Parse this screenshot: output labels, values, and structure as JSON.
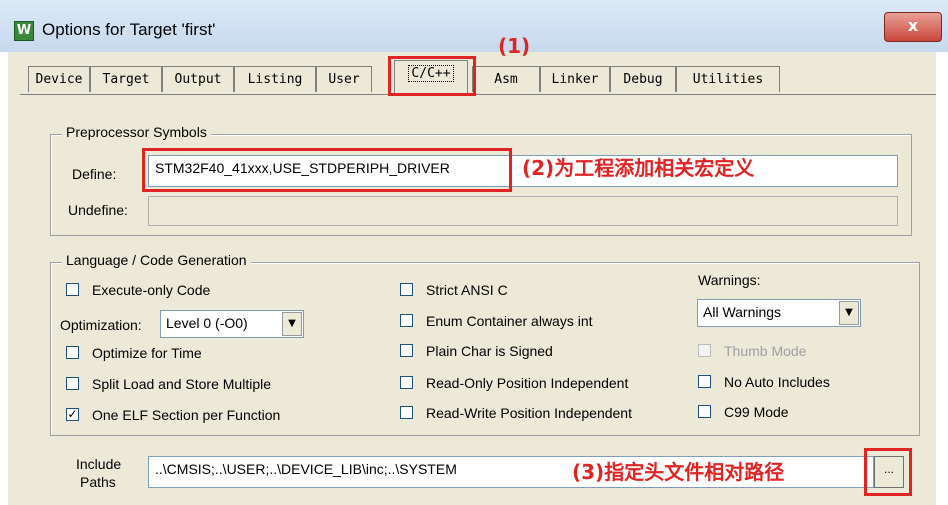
{
  "window": {
    "title": "Options for Target 'first'",
    "icon_text": "W",
    "close_label": "x"
  },
  "tabs": [
    "Device",
    "Target",
    "Output",
    "Listing",
    "User",
    "C/C++",
    "Asm",
    "Linker",
    "Debug",
    "Utilities"
  ],
  "active_tab": "C/C++",
  "preprocessor": {
    "title": "Preprocessor Symbols",
    "define_label": "Define:",
    "define_value": "STM32F40_41xxx,USE_STDPERIPH_DRIVER",
    "undefine_label": "Undefine:",
    "undefine_value": ""
  },
  "codegen": {
    "title": "Language / Code Generation",
    "execute_only": {
      "label": "Execute-only Code",
      "checked": false
    },
    "optimization_label": "Optimization:",
    "optimization_value": "Level 0 (-O0)",
    "optimize_time": {
      "label": "Optimize for Time",
      "checked": false
    },
    "split_load": {
      "label": "Split Load and Store Multiple",
      "checked": false
    },
    "one_elf": {
      "label": "One ELF Section per Function",
      "checked": true
    },
    "strict_ansi": {
      "label": "Strict ANSI C",
      "checked": false
    },
    "enum_container": {
      "label": "Enum Container always int",
      "checked": false
    },
    "plain_char": {
      "label": "Plain Char is Signed",
      "checked": false
    },
    "ro_pi": {
      "label": "Read-Only Position Independent",
      "checked": false
    },
    "rw_pi": {
      "label": "Read-Write Position Independent",
      "checked": false
    },
    "warnings_label": "Warnings:",
    "warnings_value": "All Warnings",
    "thumb_mode": {
      "label": "Thumb Mode",
      "checked": false,
      "disabled": true
    },
    "no_auto_includes": {
      "label": "No Auto Includes",
      "checked": false
    },
    "c99": {
      "label": "C99 Mode",
      "checked": false
    }
  },
  "include": {
    "label_line1": "Include",
    "label_line2": "Paths",
    "value": "..\\CMSIS;..\\USER;..\\DEVICE_LIB\\inc;..\\SYSTEM",
    "browse_label": "..."
  },
  "annotations": {
    "a1": "(1)",
    "a2": "(2)为工程添加相关宏定义",
    "a3": "(3)指定头文件相对路径"
  },
  "colors": {
    "annotation": "#e02424",
    "dialog_bg": "#ece9d8"
  }
}
